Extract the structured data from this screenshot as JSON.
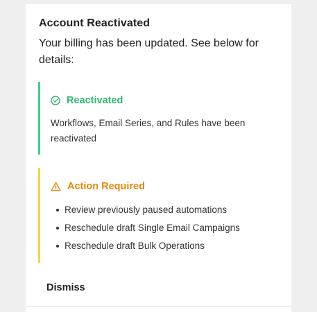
{
  "dialog": {
    "title": "Account Reactivated",
    "message": "Your billing has been updated. See below for details:"
  },
  "reactivated": {
    "icon": "check-circle-icon",
    "heading": "Reactivated",
    "body": "Workflows, Email Series, and Rules have been reactivated",
    "accent_color": "#3ecf8e",
    "text_color": "#2fb86f"
  },
  "action_required": {
    "icon": "warning-triangle-icon",
    "heading": "Action Required",
    "items": [
      "Review previously paused automations",
      "Reschedule draft Single Email Campaigns",
      "Reschedule draft Bulk Operations"
    ],
    "accent_color": "#f5d63d",
    "text_color": "#e8860c"
  },
  "footer": {
    "dismiss_label": "Dismiss"
  }
}
